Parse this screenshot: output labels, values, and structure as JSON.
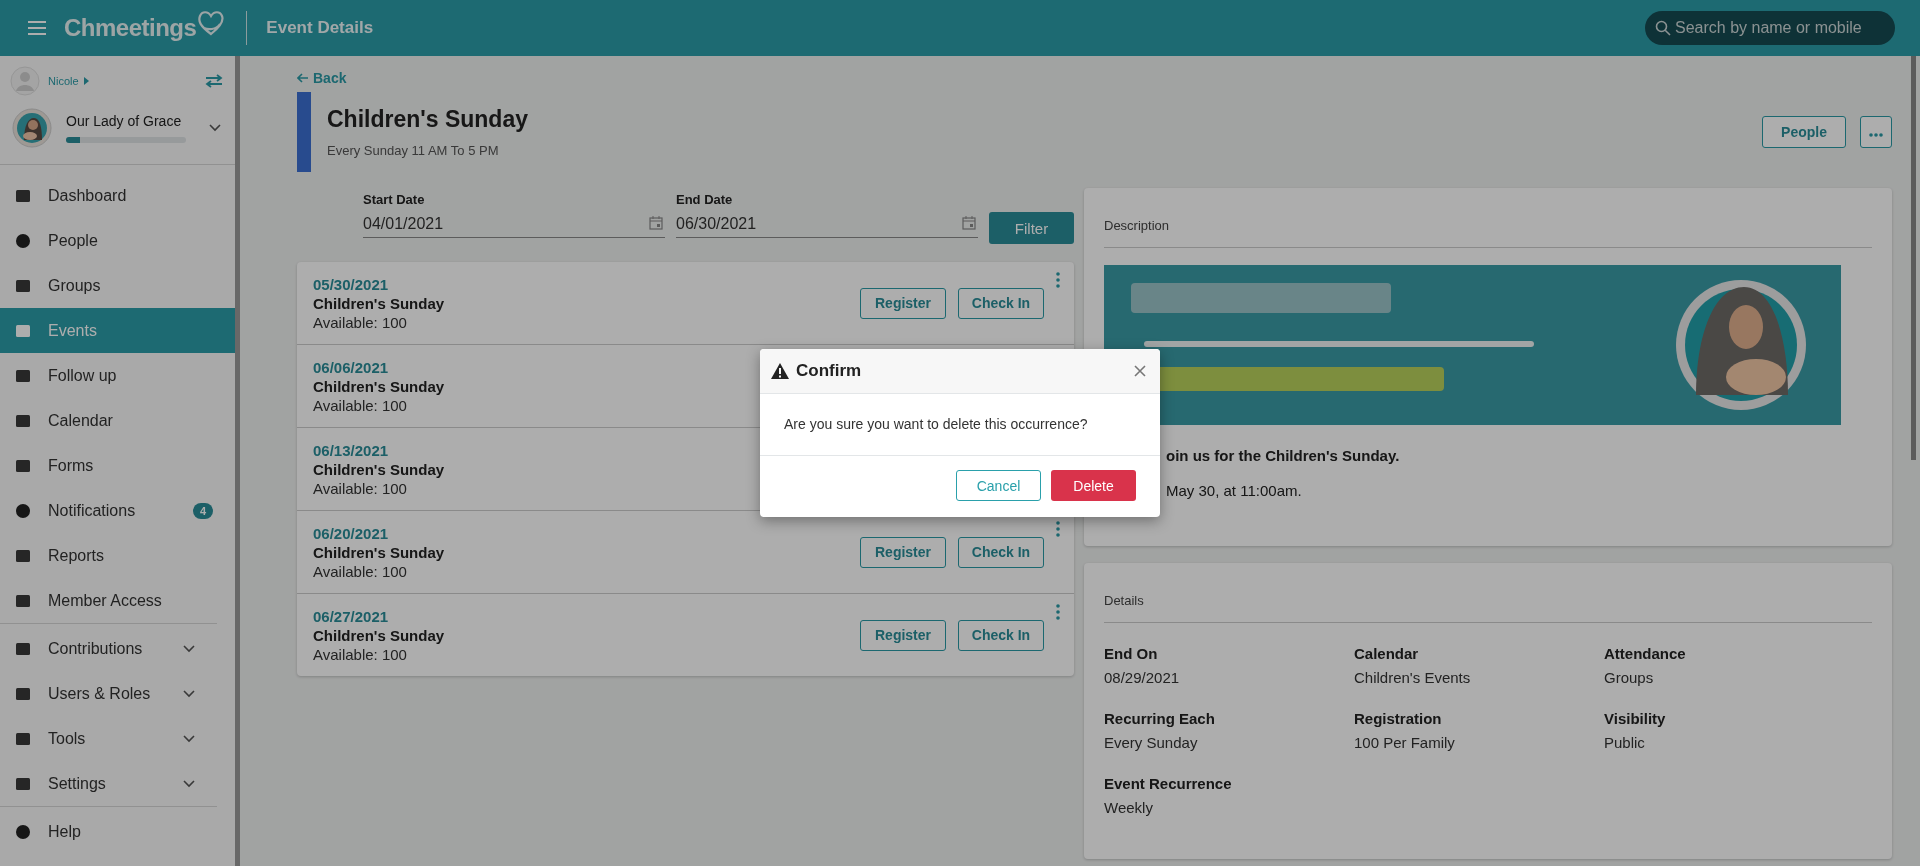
{
  "header": {
    "logo": "Chmeetings",
    "title": "Event Details",
    "search": {
      "placeholder": "Search by name or mobile"
    }
  },
  "sidebar": {
    "user": "Nicole",
    "church": {
      "name": "Our Lady of Grace",
      "level": 0.12
    },
    "sections": [
      [
        {
          "label": "Dashboard",
          "selected": false
        },
        {
          "label": "People",
          "selected": false
        },
        {
          "label": "Groups",
          "selected": false
        },
        {
          "label": "Events",
          "selected": true
        },
        {
          "label": "Follow up",
          "selected": false
        },
        {
          "label": "Calendar",
          "selected": false
        },
        {
          "label": "Forms",
          "selected": false
        },
        {
          "label": "Notifications",
          "selected": false,
          "badge": "4"
        },
        {
          "label": "Reports",
          "selected": false
        },
        {
          "label": "Member Access",
          "selected": false
        }
      ],
      [
        {
          "label": "Contributions",
          "selected": false,
          "expanded": false
        },
        {
          "label": "Users & Roles",
          "selected": false,
          "expanded": false
        },
        {
          "label": "Tools",
          "selected": false,
          "expanded": false
        },
        {
          "label": "Settings",
          "selected": false,
          "expanded": false
        }
      ],
      [
        {
          "label": "Help",
          "selected": false
        }
      ]
    ]
  },
  "event": {
    "back": "Back",
    "title": "Children's Sunday",
    "subtitle": "Every Sunday 11 AM To 5 PM",
    "actions": [
      "People"
    ]
  },
  "filter": {
    "start": {
      "label": "Start Date",
      "value": "04/01/2021"
    },
    "end": {
      "label": "End Date",
      "value": "06/30/2021"
    },
    "button": "Filter"
  },
  "occurrences": [
    {
      "date": "05/30/2021",
      "name": "Children's Sunday",
      "available": "Available: 100",
      "buttons": [
        "Register",
        "Check In"
      ]
    },
    {
      "date": "06/06/2021",
      "name": "Children's Sunday",
      "available": "Available: 100"
    },
    {
      "date": "06/13/2021",
      "name": "Children's Sunday",
      "available": "Available: 100"
    },
    {
      "date": "06/20/2021",
      "name": "Children's Sunday",
      "available": "Available: 100",
      "buttons": [
        "Register",
        "Check In"
      ]
    },
    {
      "date": "06/27/2021",
      "name": "Children's Sunday",
      "available": "Available: 100",
      "buttons": [
        "Register",
        "Check In"
      ]
    }
  ],
  "description": {
    "heading": "Description",
    "banner": {
      "kind": "picture"
    },
    "lines": [
      "oin us for the Children's Sunday.",
      "May 30, at 11:00am."
    ]
  },
  "details": {
    "heading": "Details",
    "fields": [
      {
        "label": "End On",
        "value": "08/29/2021"
      },
      {
        "label": "Calendar",
        "value": "Children's Events"
      },
      {
        "label": "Attendance",
        "value": "Groups"
      },
      {
        "label": "Recurring Each",
        "value": "Every Sunday"
      },
      {
        "label": "Registration",
        "value": "100 Per Family"
      },
      {
        "label": "Visibility",
        "value": "Public"
      },
      {
        "label": "Event Recurrence",
        "value": "Weekly"
      }
    ]
  },
  "dialog": {
    "title": "Confirm",
    "message": "Are you sure you want to delete this occurrence?",
    "buttons": [
      {
        "label": "Cancel",
        "kind": "secondary"
      },
      {
        "label": "Delete",
        "kind": "danger"
      }
    ]
  }
}
